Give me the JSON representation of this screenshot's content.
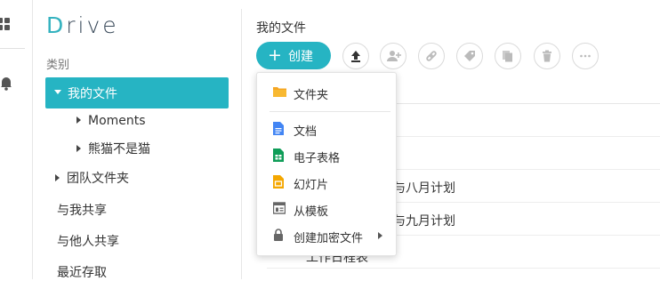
{
  "app": {
    "logo": "Drive",
    "logo_first": "D",
    "logo_rest": "rive"
  },
  "sidebar": {
    "category_label": "类别",
    "my_files": "我的文件",
    "children": [
      "Moments",
      "熊猫不是猫"
    ],
    "team_folder": "团队文件夹",
    "shared_with_me": "与我共享",
    "shared_with_others": "与他人共享",
    "recent": "最近存取"
  },
  "main": {
    "title": "我的文件",
    "create_label": "创建",
    "toolbar_icons": [
      "upload-icon",
      "add-user-icon",
      "link-icon",
      "tag-icon",
      "copy-icon",
      "trash-icon",
      "more-icon"
    ],
    "rows_partial": [
      "与八月计划",
      "与九月计划",
      "工作日程表"
    ]
  },
  "create_menu": {
    "items": [
      {
        "label": "文件夹",
        "icon": "folder-icon",
        "color": "#f5a623"
      },
      {
        "label": "文档",
        "icon": "doc-icon",
        "color": "#4285f4"
      },
      {
        "label": "电子表格",
        "icon": "sheet-icon",
        "color": "#0f9d58"
      },
      {
        "label": "幻灯片",
        "icon": "slides-icon",
        "color": "#f4a700"
      },
      {
        "label": "从模板",
        "icon": "template-icon",
        "color": "#666666"
      },
      {
        "label": "创建加密文件",
        "icon": "lock-icon",
        "color": "#666666"
      }
    ]
  },
  "colors": {
    "accent": "#26b4c3"
  }
}
